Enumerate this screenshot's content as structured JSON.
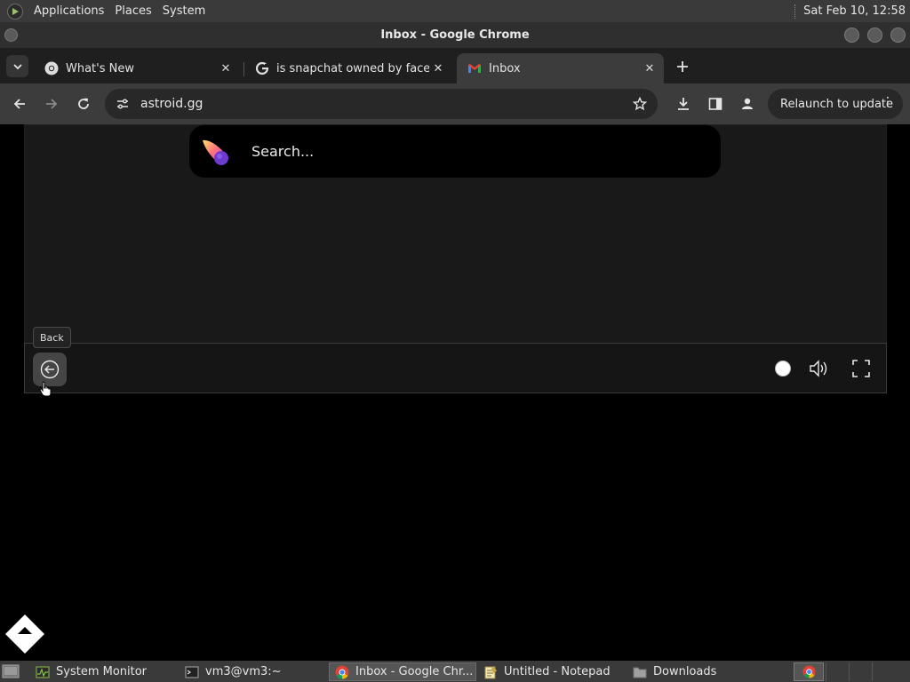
{
  "top_panel": {
    "menus": [
      "Applications",
      "Places",
      "System"
    ],
    "clock": "Sat Feb 10, 12:58"
  },
  "window": {
    "title": "Inbox - Google Chrome"
  },
  "tabs": [
    {
      "title": "What's New",
      "icon": "chrome-icon"
    },
    {
      "title": "is snapchat owned by facebook",
      "icon": "google-icon"
    },
    {
      "title": "Inbox",
      "icon": "gmail-icon",
      "active": true
    }
  ],
  "toolbar": {
    "url": "astroid.gg",
    "relaunch_label": "Relaunch to update"
  },
  "page": {
    "search_placeholder": "Search...",
    "tooltip": "Back"
  },
  "taskbar": [
    {
      "label": "System Monitor",
      "icon": "system-monitor-icon"
    },
    {
      "label": "vm3@vm3:~",
      "icon": "terminal-icon"
    },
    {
      "label": "Inbox - Google Chr...",
      "icon": "chrome-icon",
      "active": true
    },
    {
      "label": "Untitled - Notepad",
      "icon": "notepad-icon"
    },
    {
      "label": "Downloads",
      "icon": "folder-icon"
    }
  ],
  "colors": {
    "panel_bg": "#3a3a3a",
    "tabstrip_bg": "#1f1f1f",
    "toolbar_bg": "#3c3c3c",
    "page_bg": "#000000"
  }
}
